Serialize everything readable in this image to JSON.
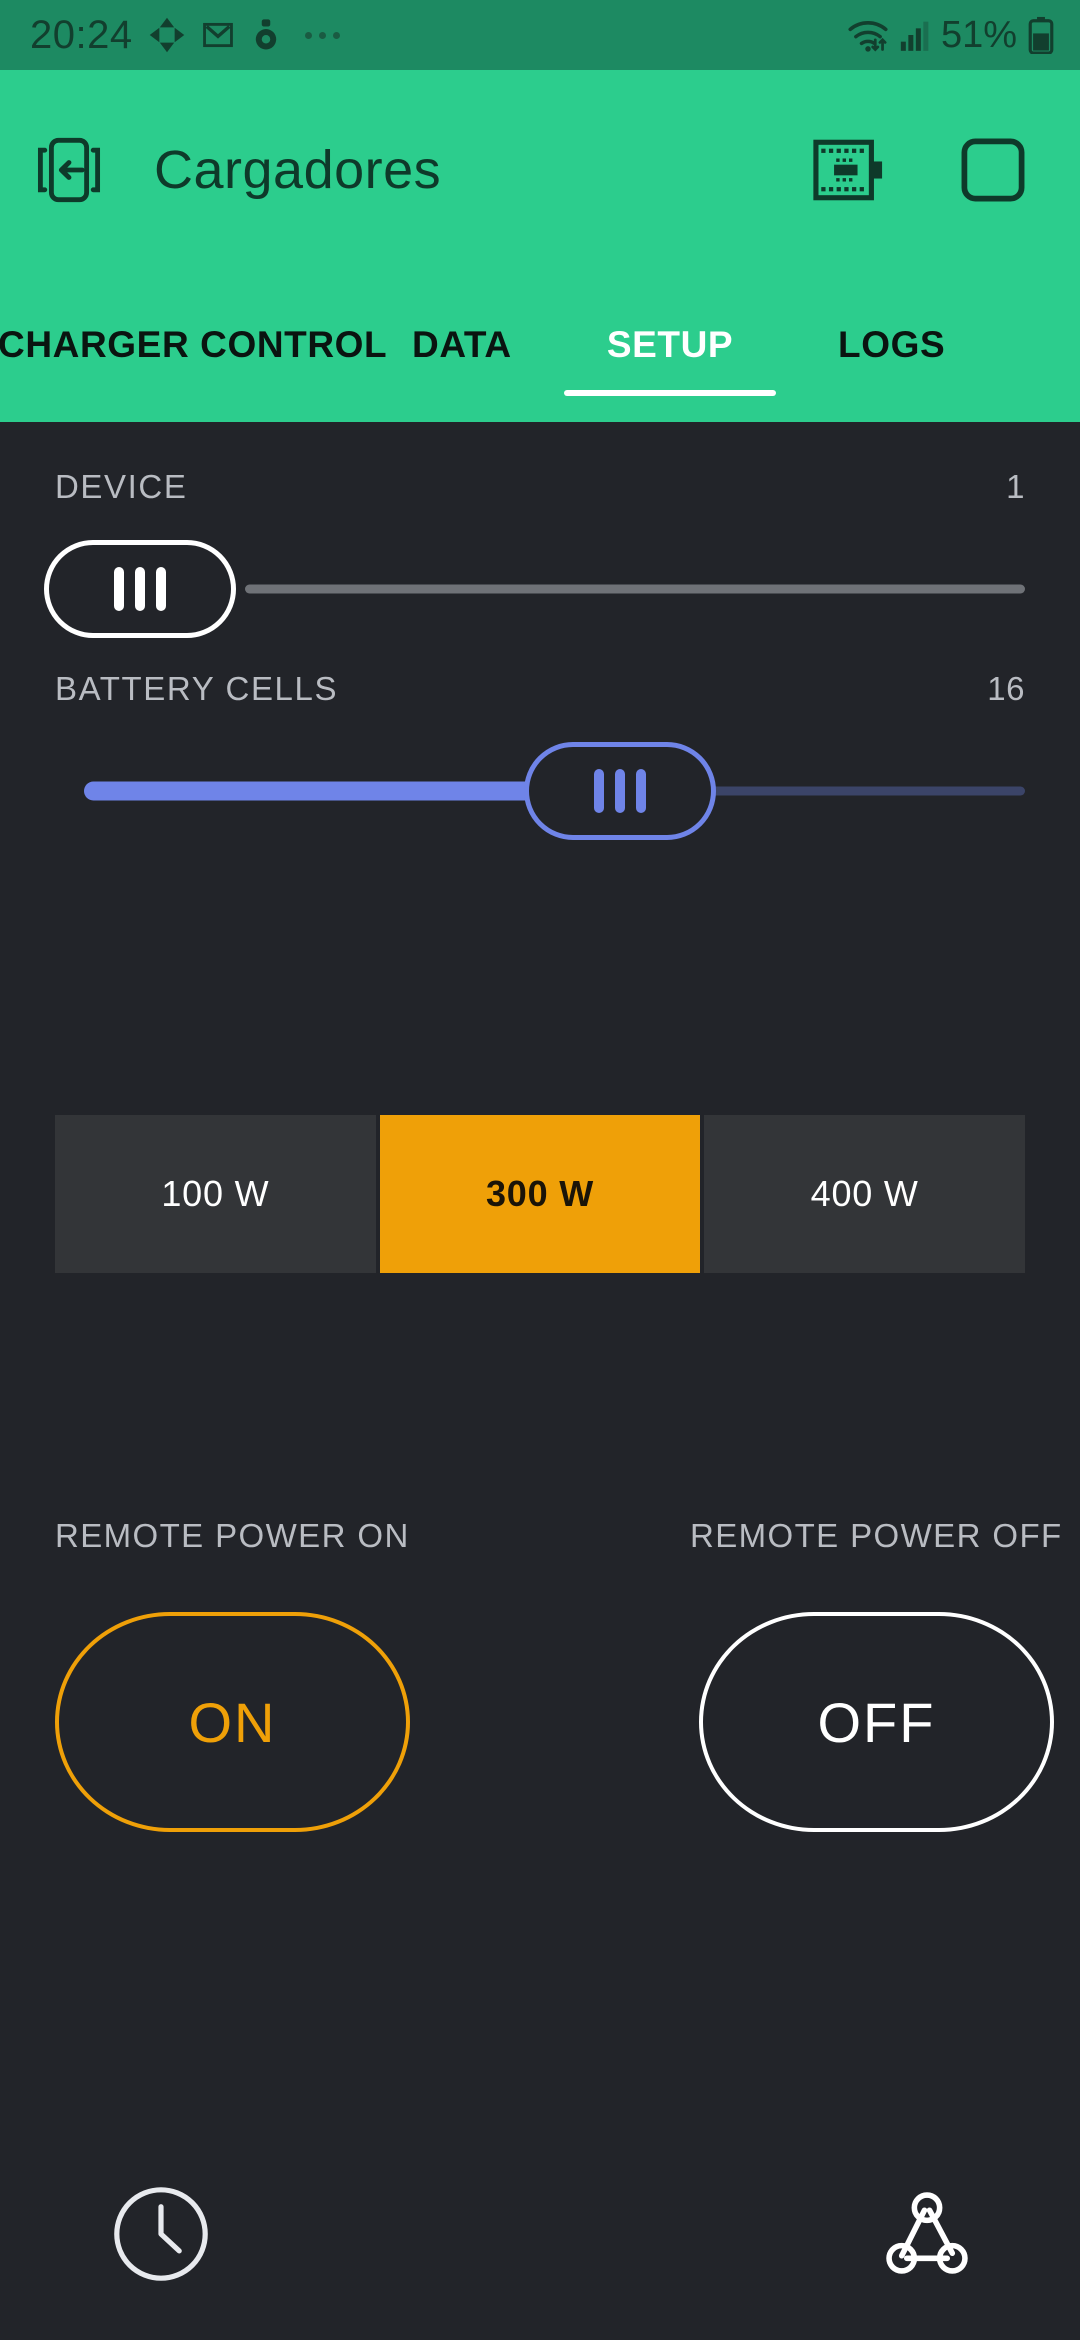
{
  "colors": {
    "status_bar_bg": "#1d8a62",
    "app_bar_bg": "#2ccd8d",
    "page_bg": "#222429",
    "accent_orange": "#efa008",
    "slider_blue": "#6f84e8",
    "label_gray": "#b9bcc2",
    "segment_bg": "#333538"
  },
  "status_bar": {
    "time": "20:24",
    "battery_percent": "51%",
    "icons": [
      "navigation-icon",
      "gmail-icon",
      "fitness-icon",
      "overflow-dots-icon",
      "wifi-icon",
      "cellular-signal-icon",
      "battery-icon"
    ]
  },
  "app_bar": {
    "title": "Cargadores",
    "back_icon": "exit-device-icon",
    "action_icons": [
      "circuit-board-icon",
      "rounded-square-icon"
    ]
  },
  "tabs": {
    "items": [
      {
        "label": "CHARGER CONTROL",
        "active": false
      },
      {
        "label": "DATA",
        "active": false
      },
      {
        "label": "SETUP",
        "active": true
      },
      {
        "label": "LOGS",
        "active": false
      }
    ],
    "active_index": 2
  },
  "setup": {
    "device_slider": {
      "label": "DEVICE",
      "value": "1",
      "min": 1,
      "max": 16,
      "percent": 0
    },
    "battery_cells_slider": {
      "label": "BATTERY CELLS",
      "value": "16",
      "min": 1,
      "max": 28,
      "percent": 58
    },
    "power_segments": {
      "options": [
        {
          "label": "100 W",
          "selected": false
        },
        {
          "label": "300 W",
          "selected": true
        },
        {
          "label": "400 W",
          "selected": false
        }
      ],
      "selected_label": "300 W"
    },
    "remote_power_on": {
      "label": "REMOTE POWER ON",
      "button_label": "ON"
    },
    "remote_power_off": {
      "label": "REMOTE POWER OFF",
      "button_label": "OFF"
    }
  },
  "bottom_bar": {
    "clock_icon": "clock-icon",
    "node_icon": "triangle-node-icon"
  }
}
